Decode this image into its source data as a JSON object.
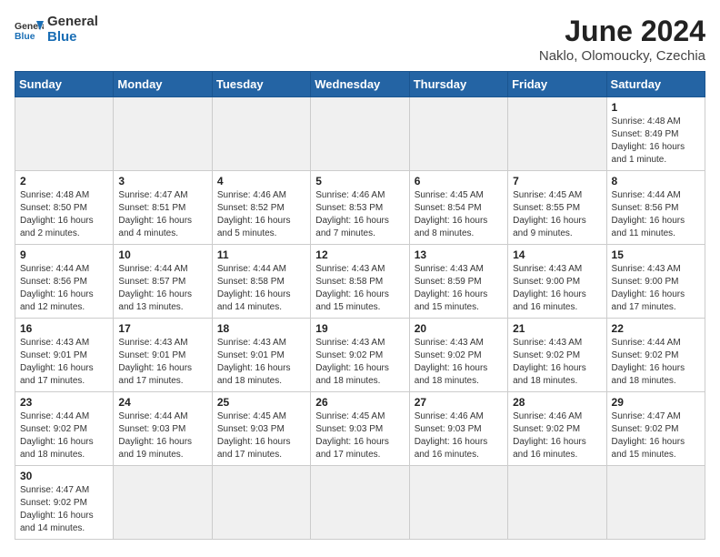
{
  "header": {
    "logo_general": "General",
    "logo_blue": "Blue",
    "title": "June 2024",
    "subtitle": "Naklo, Olomoucky, Czechia"
  },
  "weekdays": [
    "Sunday",
    "Monday",
    "Tuesday",
    "Wednesday",
    "Thursday",
    "Friday",
    "Saturday"
  ],
  "weeks": [
    [
      {
        "day": "",
        "info": ""
      },
      {
        "day": "",
        "info": ""
      },
      {
        "day": "",
        "info": ""
      },
      {
        "day": "",
        "info": ""
      },
      {
        "day": "",
        "info": ""
      },
      {
        "day": "",
        "info": ""
      },
      {
        "day": "1",
        "info": "Sunrise: 4:48 AM\nSunset: 8:49 PM\nDaylight: 16 hours\nand 1 minute."
      }
    ],
    [
      {
        "day": "2",
        "info": "Sunrise: 4:48 AM\nSunset: 8:50 PM\nDaylight: 16 hours\nand 2 minutes."
      },
      {
        "day": "3",
        "info": "Sunrise: 4:47 AM\nSunset: 8:51 PM\nDaylight: 16 hours\nand 4 minutes."
      },
      {
        "day": "4",
        "info": "Sunrise: 4:46 AM\nSunset: 8:52 PM\nDaylight: 16 hours\nand 5 minutes."
      },
      {
        "day": "5",
        "info": "Sunrise: 4:46 AM\nSunset: 8:53 PM\nDaylight: 16 hours\nand 7 minutes."
      },
      {
        "day": "6",
        "info": "Sunrise: 4:45 AM\nSunset: 8:54 PM\nDaylight: 16 hours\nand 8 minutes."
      },
      {
        "day": "7",
        "info": "Sunrise: 4:45 AM\nSunset: 8:55 PM\nDaylight: 16 hours\nand 9 minutes."
      },
      {
        "day": "8",
        "info": "Sunrise: 4:44 AM\nSunset: 8:56 PM\nDaylight: 16 hours\nand 11 minutes."
      }
    ],
    [
      {
        "day": "9",
        "info": "Sunrise: 4:44 AM\nSunset: 8:56 PM\nDaylight: 16 hours\nand 12 minutes."
      },
      {
        "day": "10",
        "info": "Sunrise: 4:44 AM\nSunset: 8:57 PM\nDaylight: 16 hours\nand 13 minutes."
      },
      {
        "day": "11",
        "info": "Sunrise: 4:44 AM\nSunset: 8:58 PM\nDaylight: 16 hours\nand 14 minutes."
      },
      {
        "day": "12",
        "info": "Sunrise: 4:43 AM\nSunset: 8:58 PM\nDaylight: 16 hours\nand 15 minutes."
      },
      {
        "day": "13",
        "info": "Sunrise: 4:43 AM\nSunset: 8:59 PM\nDaylight: 16 hours\nand 15 minutes."
      },
      {
        "day": "14",
        "info": "Sunrise: 4:43 AM\nSunset: 9:00 PM\nDaylight: 16 hours\nand 16 minutes."
      },
      {
        "day": "15",
        "info": "Sunrise: 4:43 AM\nSunset: 9:00 PM\nDaylight: 16 hours\nand 17 minutes."
      }
    ],
    [
      {
        "day": "16",
        "info": "Sunrise: 4:43 AM\nSunset: 9:01 PM\nDaylight: 16 hours\nand 17 minutes."
      },
      {
        "day": "17",
        "info": "Sunrise: 4:43 AM\nSunset: 9:01 PM\nDaylight: 16 hours\nand 17 minutes."
      },
      {
        "day": "18",
        "info": "Sunrise: 4:43 AM\nSunset: 9:01 PM\nDaylight: 16 hours\nand 18 minutes."
      },
      {
        "day": "19",
        "info": "Sunrise: 4:43 AM\nSunset: 9:02 PM\nDaylight: 16 hours\nand 18 minutes."
      },
      {
        "day": "20",
        "info": "Sunrise: 4:43 AM\nSunset: 9:02 PM\nDaylight: 16 hours\nand 18 minutes."
      },
      {
        "day": "21",
        "info": "Sunrise: 4:43 AM\nSunset: 9:02 PM\nDaylight: 16 hours\nand 18 minutes."
      },
      {
        "day": "22",
        "info": "Sunrise: 4:44 AM\nSunset: 9:02 PM\nDaylight: 16 hours\nand 18 minutes."
      }
    ],
    [
      {
        "day": "23",
        "info": "Sunrise: 4:44 AM\nSunset: 9:02 PM\nDaylight: 16 hours\nand 18 minutes."
      },
      {
        "day": "24",
        "info": "Sunrise: 4:44 AM\nSunset: 9:03 PM\nDaylight: 16 hours\nand 19 minutes."
      },
      {
        "day": "25",
        "info": "Sunrise: 4:45 AM\nSunset: 9:03 PM\nDaylight: 16 hours\nand 17 minutes."
      },
      {
        "day": "26",
        "info": "Sunrise: 4:45 AM\nSunset: 9:03 PM\nDaylight: 16 hours\nand 17 minutes."
      },
      {
        "day": "27",
        "info": "Sunrise: 4:46 AM\nSunset: 9:03 PM\nDaylight: 16 hours\nand 16 minutes."
      },
      {
        "day": "28",
        "info": "Sunrise: 4:46 AM\nSunset: 9:02 PM\nDaylight: 16 hours\nand 16 minutes."
      },
      {
        "day": "29",
        "info": "Sunrise: 4:47 AM\nSunset: 9:02 PM\nDaylight: 16 hours\nand 15 minutes."
      }
    ],
    [
      {
        "day": "30",
        "info": "Sunrise: 4:47 AM\nSunset: 9:02 PM\nDaylight: 16 hours\nand 14 minutes."
      },
      {
        "day": "",
        "info": ""
      },
      {
        "day": "",
        "info": ""
      },
      {
        "day": "",
        "info": ""
      },
      {
        "day": "",
        "info": ""
      },
      {
        "day": "",
        "info": ""
      },
      {
        "day": "",
        "info": ""
      }
    ]
  ]
}
